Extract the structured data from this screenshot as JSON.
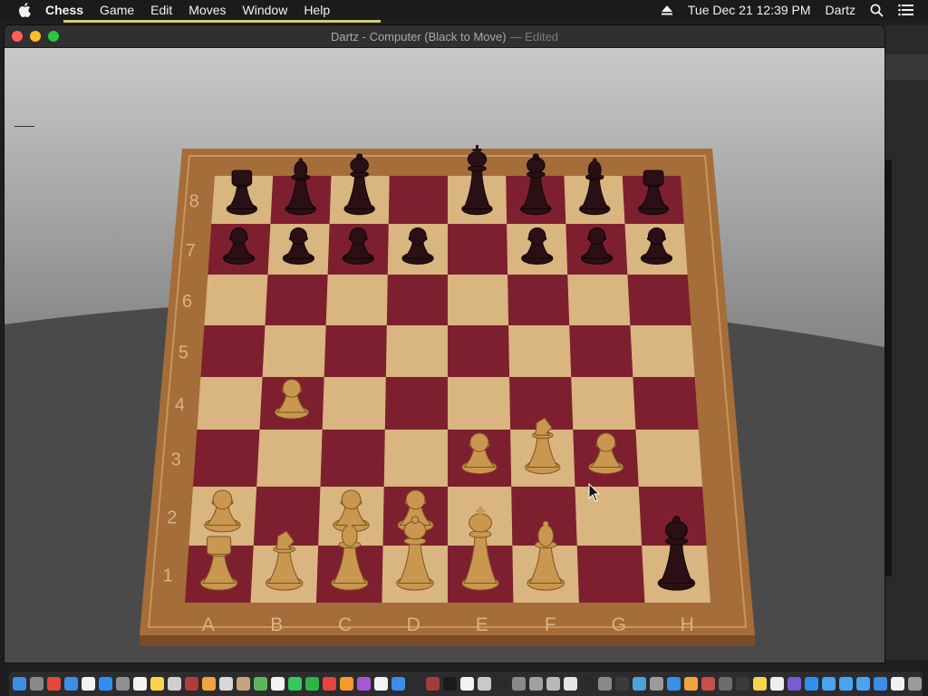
{
  "menubar": {
    "app": "Chess",
    "items": [
      "Game",
      "Edit",
      "Moves",
      "Window",
      "Help"
    ],
    "datetime": "Tue Dec 21  12:39 PM",
    "user": "Dartz"
  },
  "window": {
    "title": "Dartz - Computer   (Black to Move)",
    "edited": "— Edited"
  },
  "board": {
    "files": [
      "A",
      "B",
      "C",
      "D",
      "E",
      "F",
      "G",
      "H"
    ],
    "ranks": [
      "8",
      "7",
      "6",
      "5",
      "4",
      "3",
      "2",
      "1"
    ],
    "light_square": "#d9b57f",
    "dark_square": "#7e1f30",
    "frame_color": "#b07a43",
    "pieces": [
      {
        "square": "a8",
        "color": "black",
        "type": "rook"
      },
      {
        "square": "b8",
        "color": "black",
        "type": "bishop"
      },
      {
        "square": "c8",
        "color": "black",
        "type": "queen"
      },
      {
        "square": "e8",
        "color": "black",
        "type": "king"
      },
      {
        "square": "f8",
        "color": "black",
        "type": "queen"
      },
      {
        "square": "g8",
        "color": "black",
        "type": "bishop"
      },
      {
        "square": "h8",
        "color": "black",
        "type": "rook"
      },
      {
        "square": "a7",
        "color": "black",
        "type": "pawn"
      },
      {
        "square": "b7",
        "color": "black",
        "type": "pawn"
      },
      {
        "square": "c7",
        "color": "black",
        "type": "pawn"
      },
      {
        "square": "d7",
        "color": "black",
        "type": "pawn"
      },
      {
        "square": "f7",
        "color": "black",
        "type": "pawn"
      },
      {
        "square": "g7",
        "color": "black",
        "type": "pawn"
      },
      {
        "square": "h7",
        "color": "black",
        "type": "pawn"
      },
      {
        "square": "h1",
        "color": "black",
        "type": "queen"
      },
      {
        "square": "b4",
        "color": "white",
        "type": "pawn"
      },
      {
        "square": "e3",
        "color": "white",
        "type": "pawn"
      },
      {
        "square": "f3",
        "color": "white",
        "type": "knight"
      },
      {
        "square": "g3",
        "color": "white",
        "type": "pawn"
      },
      {
        "square": "a2",
        "color": "white",
        "type": "pawn"
      },
      {
        "square": "c2",
        "color": "white",
        "type": "pawn"
      },
      {
        "square": "d2",
        "color": "white",
        "type": "pawn"
      },
      {
        "square": "a1",
        "color": "white",
        "type": "rook"
      },
      {
        "square": "b1",
        "color": "white",
        "type": "knight"
      },
      {
        "square": "c1",
        "color": "white",
        "type": "bishop"
      },
      {
        "square": "d1",
        "color": "white",
        "type": "queen"
      },
      {
        "square": "e1",
        "color": "white",
        "type": "king"
      },
      {
        "square": "f1",
        "color": "white",
        "type": "bishop"
      }
    ]
  },
  "dock": {
    "icons": [
      {
        "name": "finder-icon",
        "color": "#3a8ee6"
      },
      {
        "name": "launchpad-icon",
        "color": "#8a8a8a"
      },
      {
        "name": "chrome-icon",
        "color": "#e4473b"
      },
      {
        "name": "safari-icon",
        "color": "#3b8fe5"
      },
      {
        "name": "music-icon",
        "color": "#f2f2f2"
      },
      {
        "name": "app-store-icon",
        "color": "#2e8ff0"
      },
      {
        "name": "system-preferences-icon",
        "color": "#8e8e93"
      },
      {
        "name": "calendar-icon",
        "color": "#f2f2f2"
      },
      {
        "name": "notes-icon",
        "color": "#f7d44a"
      },
      {
        "name": "preview-icon",
        "color": "#cfcfcf"
      },
      {
        "name": "photo-booth-icon",
        "color": "#b03b3b"
      },
      {
        "name": "home-icon",
        "color": "#f2a53a"
      },
      {
        "name": "script-editor-icon",
        "color": "#d8d8d8"
      },
      {
        "name": "contacts-icon",
        "color": "#c5a37c"
      },
      {
        "name": "maps-icon",
        "color": "#5bb65b"
      },
      {
        "name": "reminders-icon",
        "color": "#f2f2f2"
      },
      {
        "name": "messages-icon",
        "color": "#34c759"
      },
      {
        "name": "facetime-icon",
        "color": "#2fb544"
      },
      {
        "name": "news-icon",
        "color": "#e7443e"
      },
      {
        "name": "books-icon",
        "color": "#f39a2b"
      },
      {
        "name": "podcasts-icon",
        "color": "#a856d6"
      },
      {
        "name": "photos-icon",
        "color": "#f2f2f2"
      },
      {
        "name": "mail-icon",
        "color": "#3a8ee6"
      },
      {
        "name": "stocks-icon",
        "color": "#2c2c2c"
      },
      {
        "name": "dictionary-icon",
        "color": "#a33b3b"
      },
      {
        "name": "terminal-icon",
        "color": "#1a1a1a"
      },
      {
        "name": "textedit-icon",
        "color": "#f2f2f2"
      },
      {
        "name": "chess-icon",
        "color": "#c9c9c9"
      },
      {
        "name": "activity-monitor-icon",
        "color": "#2b2b2b"
      },
      {
        "name": "screenshot-icon",
        "color": "#8a8a8a"
      },
      {
        "name": "disk-utility-icon",
        "color": "#a0a0a0"
      },
      {
        "name": "keychain-icon",
        "color": "#b8b8b8"
      },
      {
        "name": "font-book-icon",
        "color": "#e5e5e5"
      },
      {
        "name": "voiceover-icon",
        "color": "#2a2a2a"
      },
      {
        "name": "automator-icon",
        "color": "#8a8a8a"
      },
      {
        "name": "console-icon",
        "color": "#3b3b3b"
      },
      {
        "name": "grapher-icon",
        "color": "#4aa3d8"
      },
      {
        "name": "migration-icon",
        "color": "#9a9a9a"
      },
      {
        "name": "bluetooth-icon",
        "color": "#3a8ee6"
      },
      {
        "name": "colorsync-icon",
        "color": "#f2a53a"
      },
      {
        "name": "digital-color-icon",
        "color": "#c44f4f"
      },
      {
        "name": "image-capture-icon",
        "color": "#6c6c6c"
      },
      {
        "name": "quicktime-icon",
        "color": "#3b3b3b"
      },
      {
        "name": "stickies-icon",
        "color": "#f7d44a"
      },
      {
        "name": "photo-icon",
        "color": "#ededed"
      },
      {
        "name": "feedback-icon",
        "color": "#7a5bd6"
      },
      {
        "name": "app-store-folder-icon",
        "color": "#2e8ff0"
      },
      {
        "name": "folder-icon",
        "color": "#4aa3f0"
      },
      {
        "name": "folder-2-icon",
        "color": "#4aa3f0"
      },
      {
        "name": "folder-3-icon",
        "color": "#4aa3f0"
      },
      {
        "name": "downloads-icon",
        "color": "#3a8ee6"
      },
      {
        "name": "document-icon",
        "color": "#f2f2f2"
      },
      {
        "name": "trash-icon",
        "color": "#9a9a9a"
      }
    ]
  }
}
